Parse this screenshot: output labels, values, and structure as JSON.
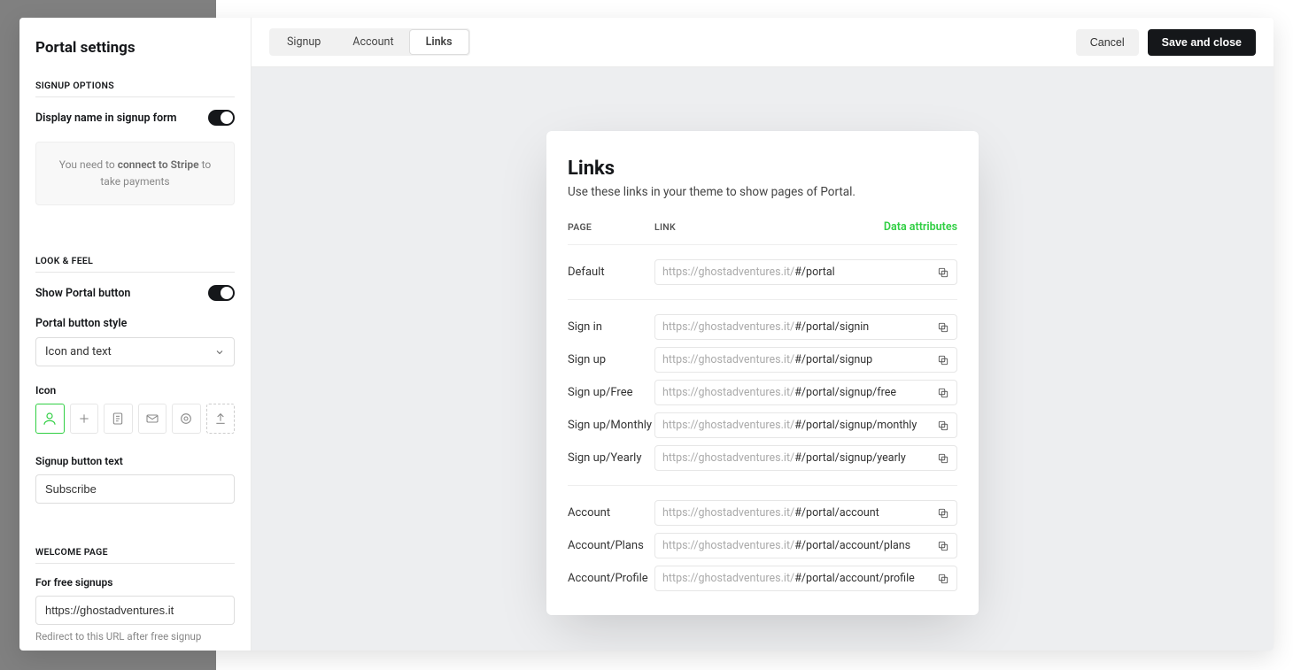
{
  "sidebar": {
    "title": "Portal settings",
    "signup_options": {
      "heading": "SIGNUP OPTIONS",
      "display_name_label": "Display name in signup form",
      "notice_prefix": "You need to ",
      "notice_bold": "connect to Stripe",
      "notice_suffix": " to take payments"
    },
    "look_feel": {
      "heading": "LOOK & FEEL",
      "show_portal_label": "Show Portal button",
      "button_style_label": "Portal button style",
      "button_style_value": "Icon and text",
      "icon_label": "Icon",
      "signup_button_text_label": "Signup button text",
      "signup_button_text_value": "Subscribe"
    },
    "welcome": {
      "heading": "WELCOME PAGE",
      "free_label": "For free signups",
      "free_value": "https://ghostadventures.it",
      "free_helper": "Redirect to this URL after free signup"
    }
  },
  "topbar": {
    "tabs": {
      "signup": "Signup",
      "account": "Account",
      "links": "Links"
    },
    "cancel": "Cancel",
    "save": "Save and close"
  },
  "card": {
    "title": "Links",
    "desc": "Use these links in your theme to show pages of Portal.",
    "col_page": "PAGE",
    "col_link": "LINK",
    "data_attrs": "Data attributes",
    "domain": "https://ghostadventures.it/",
    "groups": [
      [
        {
          "page": "Default",
          "path": "#/portal"
        }
      ],
      [
        {
          "page": "Sign in",
          "path": "#/portal/signin"
        },
        {
          "page": "Sign up",
          "path": "#/portal/signup"
        },
        {
          "page": "Sign up/Free",
          "path": "#/portal/signup/free"
        },
        {
          "page": "Sign up/Monthly",
          "path": "#/portal/signup/monthly"
        },
        {
          "page": "Sign up/Yearly",
          "path": "#/portal/signup/yearly"
        }
      ],
      [
        {
          "page": "Account",
          "path": "#/portal/account"
        },
        {
          "page": "Account/Plans",
          "path": "#/portal/account/plans"
        },
        {
          "page": "Account/Profile",
          "path": "#/portal/account/profile"
        }
      ]
    ]
  }
}
